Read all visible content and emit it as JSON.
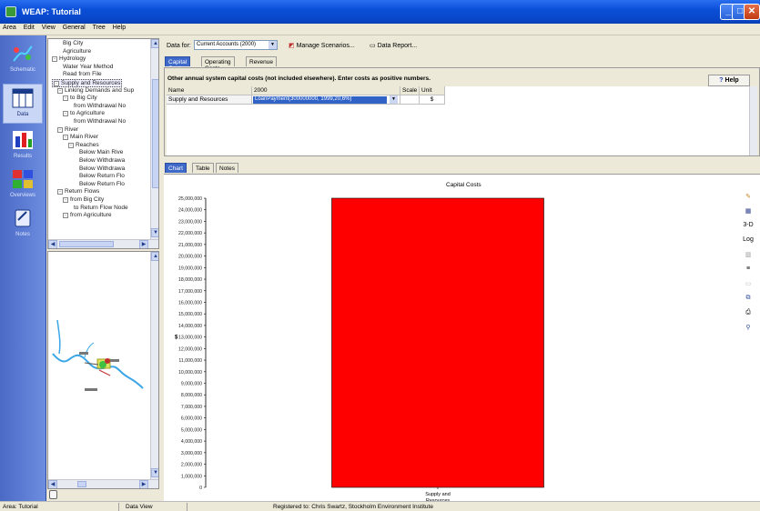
{
  "window": {
    "title": "WEAP: Tutorial"
  },
  "menu": [
    "Area",
    "Edit",
    "View",
    "General",
    "Tree",
    "Help"
  ],
  "nav": [
    {
      "label": "Schematic",
      "icon": "schematic-icon"
    },
    {
      "label": "Data",
      "icon": "data-icon",
      "active": true
    },
    {
      "label": "Results",
      "icon": "results-icon"
    },
    {
      "label": "Overviews",
      "icon": "overviews-icon"
    },
    {
      "label": "Notes",
      "icon": "notes-icon"
    }
  ],
  "tree": [
    {
      "label": "Big City",
      "indent": 2
    },
    {
      "label": "Agriculture",
      "indent": 2
    },
    {
      "label": "Hydrology",
      "indent": 0,
      "exp": "-"
    },
    {
      "label": "Water Year Method",
      "indent": 2
    },
    {
      "label": "Read from File",
      "indent": 2
    },
    {
      "label": "Supply and Resources",
      "indent": 0,
      "exp": "-",
      "selected": true
    },
    {
      "label": "Linking Demands and Sup",
      "indent": 1,
      "exp": "-"
    },
    {
      "label": "to Big City",
      "indent": 2,
      "exp": "-"
    },
    {
      "label": "from Withdrawal No",
      "indent": 4
    },
    {
      "label": "to Agriculture",
      "indent": 2,
      "exp": "-"
    },
    {
      "label": "from Withdrawal No",
      "indent": 4
    },
    {
      "label": "River",
      "indent": 1,
      "exp": "-"
    },
    {
      "label": "Main River",
      "indent": 2,
      "exp": "-"
    },
    {
      "label": "Reaches",
      "indent": 3,
      "exp": "-"
    },
    {
      "label": "Below Main Rive",
      "indent": 5
    },
    {
      "label": "Below Withdrawa",
      "indent": 5
    },
    {
      "label": "Below Withdrawa",
      "indent": 5
    },
    {
      "label": "Below Return Flo",
      "indent": 5
    },
    {
      "label": "Below Return Flo",
      "indent": 5
    },
    {
      "label": "Return Flows",
      "indent": 1,
      "exp": "-"
    },
    {
      "label": "from Big City",
      "indent": 2,
      "exp": "-"
    },
    {
      "label": "to Return Flow Node",
      "indent": 4
    },
    {
      "label": "from Agriculture",
      "indent": 2,
      "exp": "-"
    }
  ],
  "datafor": {
    "label": "Data for:",
    "value": "Current Accounts (2000)",
    "manage_scenarios": "Manage Scenarios...",
    "data_report": "Data Report..."
  },
  "tabs_top": [
    "Capital Costs",
    "Operating Costs",
    "Revenue"
  ],
  "capital": {
    "description": "Other annual system capital costs (not included elsewhere).  Enter costs as positive numbers.",
    "help": "Help",
    "headers": [
      "Name",
      "2000",
      "Scale",
      "Unit"
    ],
    "row": {
      "name": "Supply and Resources",
      "expression": "LoanPayment(300000000, 1999,20,6%)",
      "scale": "",
      "unit": "$"
    }
  },
  "tabs_bottom": [
    "Chart",
    "Table",
    "Notes"
  ],
  "toolbar_right": [
    "3-D",
    "Log"
  ],
  "chart_data": {
    "type": "bar",
    "title": "Capital Costs",
    "categories": [
      "Supply and Resources"
    ],
    "series": [
      {
        "values": [
          25000000
        ],
        "color": "#ff0000"
      }
    ],
    "ylabel": "$",
    "xlabel": "",
    "ylim": [
      0,
      25000000
    ],
    "yticks": [
      0,
      1000000,
      2000000,
      3000000,
      4000000,
      5000000,
      6000000,
      7000000,
      8000000,
      9000000,
      10000000,
      11000000,
      12000000,
      13000000,
      14000000,
      15000000,
      16000000,
      17000000,
      18000000,
      19000000,
      20000000,
      21000000,
      22000000,
      23000000,
      24000000,
      25000000
    ],
    "grid": false,
    "legend": "none"
  },
  "status": {
    "area": "Area: Tutorial",
    "view": "Data View",
    "registered": "Registered to: Chris Swartz, Stockholm Environment Institute"
  }
}
